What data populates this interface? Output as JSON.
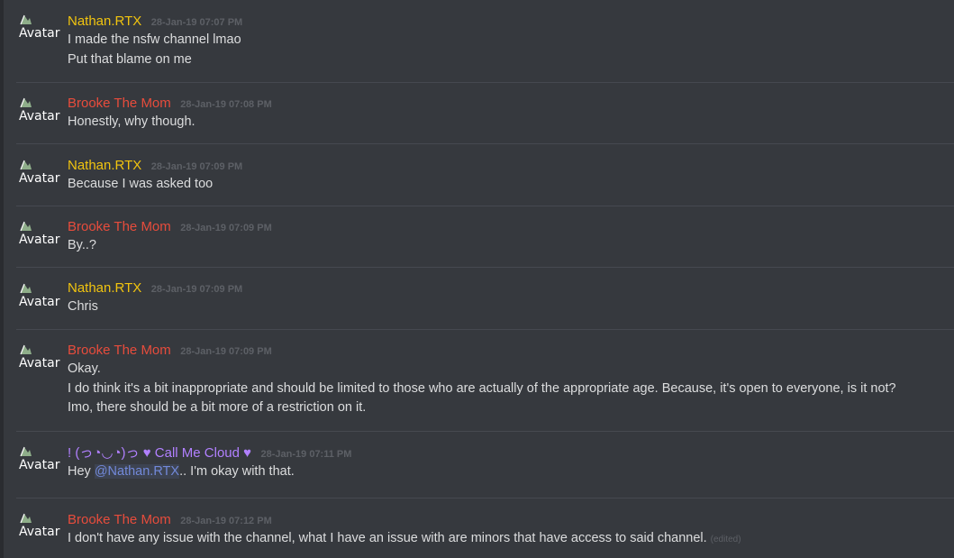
{
  "colors": {
    "nathan": "#f1c40f",
    "brooke": "#e74c3c",
    "cloud": "#b180ff",
    "text": "#dcddde",
    "mention": "#7289da"
  },
  "avatar_alt": "Avatar",
  "messages": [
    {
      "author": "Nathan.RTX",
      "color": "#f1c40f",
      "timestamp": "28-Jan-19 07:07 PM",
      "lines": [
        "I made the nsfw channel lmao",
        "Put that blame on me"
      ]
    },
    {
      "author": "Brooke The Mom",
      "color": "#e74c3c",
      "timestamp": "28-Jan-19 07:08 PM",
      "lines": [
        "Honestly, why though."
      ]
    },
    {
      "author": "Nathan.RTX",
      "color": "#f1c40f",
      "timestamp": "28-Jan-19 07:09 PM",
      "lines": [
        "Because I was asked too"
      ]
    },
    {
      "author": "Brooke The Mom",
      "color": "#e74c3c",
      "timestamp": "28-Jan-19 07:09 PM",
      "lines": [
        "By..?"
      ]
    },
    {
      "author": "Nathan.RTX",
      "color": "#f1c40f",
      "timestamp": "28-Jan-19 07:09 PM",
      "lines": [
        "Chris"
      ]
    },
    {
      "author": "Brooke The Mom",
      "color": "#e74c3c",
      "timestamp": "28-Jan-19 07:09 PM",
      "lines": [
        "Okay.",
        "I do think it's a bit inappropriate and should be limited to those who are actually of the appropriate age. Because, it's open to everyone, is it not?",
        "Imo, there should be a bit more of a restriction on it."
      ]
    },
    {
      "author": "! (っ◔◡◔)っ ♥ Call Me Cloud ♥",
      "color": "#b180ff",
      "timestamp": "28-Jan-19 07:11 PM",
      "lines": [],
      "mention_line": {
        "before": "Hey ",
        "mention": "@Nathan.RTX",
        "after": ".. I'm okay with that."
      }
    },
    {
      "author": "Brooke The Mom",
      "color": "#e74c3c",
      "timestamp": "28-Jan-19 07:12 PM",
      "lines": [],
      "edited_line": {
        "text": "I don't have any issue with the channel, what I have an issue with are minors that have access to said channel.",
        "edited": "(edited)"
      }
    }
  ]
}
